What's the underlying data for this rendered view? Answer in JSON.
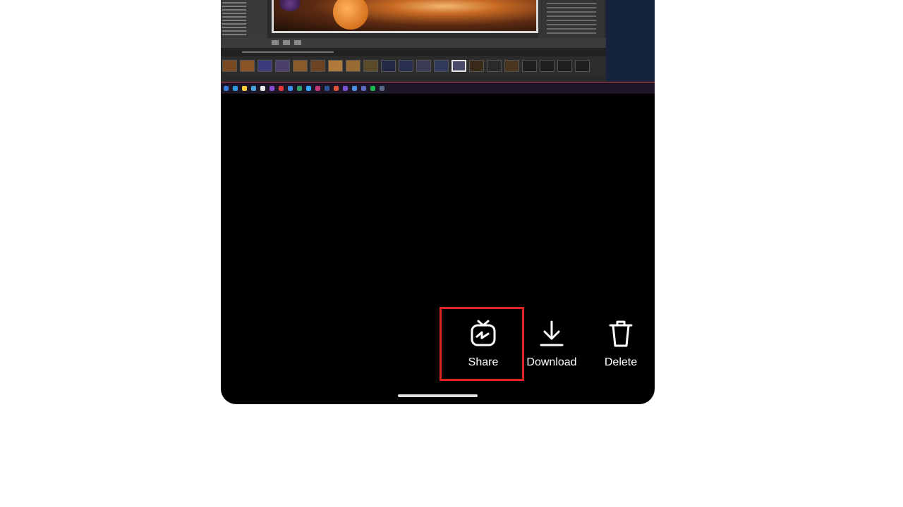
{
  "screenshot": {
    "description_colors": {
      "photo_glow": "#c86a24",
      "taskbar_accent": "#6e2b3d",
      "far_panel": "#15243a"
    }
  },
  "actions": [
    {
      "label": "Share",
      "icon": "igtv-icon"
    },
    {
      "label": "Download",
      "icon": "download-icon"
    },
    {
      "label": "Delete",
      "icon": "trash-icon"
    }
  ],
  "highlight": {
    "target": "Share",
    "color": "#e02424"
  }
}
